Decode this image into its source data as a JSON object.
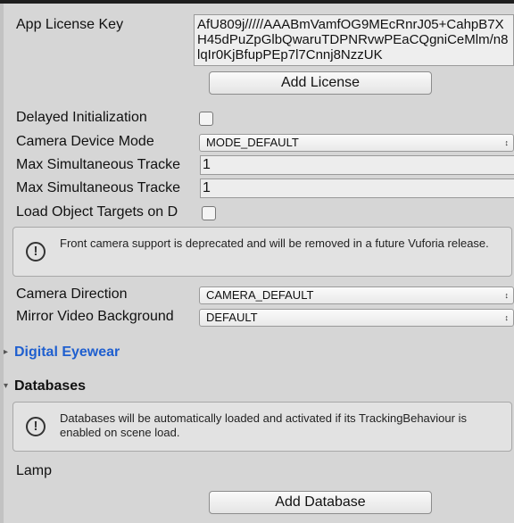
{
  "license": {
    "label": "App License Key",
    "value": "AfU809j/////AAABmVamfOG9MEcRnrJ05+CahpB7XH45dPuZpGlbQwaruTDPNRvwPEaCQgniCeMlm/n8lqIr0KjBfupPEp7l7Cnnj8NzzUK",
    "add_button": "Add License"
  },
  "settings": {
    "delayed_init_label": "Delayed Initialization",
    "camera_device_mode_label": "Camera Device Mode",
    "camera_device_mode_value": "MODE_DEFAULT",
    "max_sim_1_label": "Max Simultaneous Tracke",
    "max_sim_1_value": "1",
    "max_sim_2_label": "Max Simultaneous Tracke",
    "max_sim_2_value": "1",
    "load_object_label": "Load Object Targets on D"
  },
  "front_camera_help": "Front camera support is deprecated and will be removed in a future Vuforia release.",
  "camera": {
    "direction_label": "Camera Direction",
    "direction_value": "CAMERA_DEFAULT",
    "mirror_label": "Mirror Video Background",
    "mirror_value": "DEFAULT"
  },
  "digital_eyewear": {
    "title": "Digital Eyewear"
  },
  "databases": {
    "title": "Databases",
    "help": "Databases will be automatically loaded and activated if its TrackingBehaviour is enabled on scene load.",
    "items": [
      "Lamp"
    ],
    "add_button": "Add Database"
  },
  "colors": {
    "panel": "#d6d6d6",
    "link_blue": "#1f5fcf"
  }
}
